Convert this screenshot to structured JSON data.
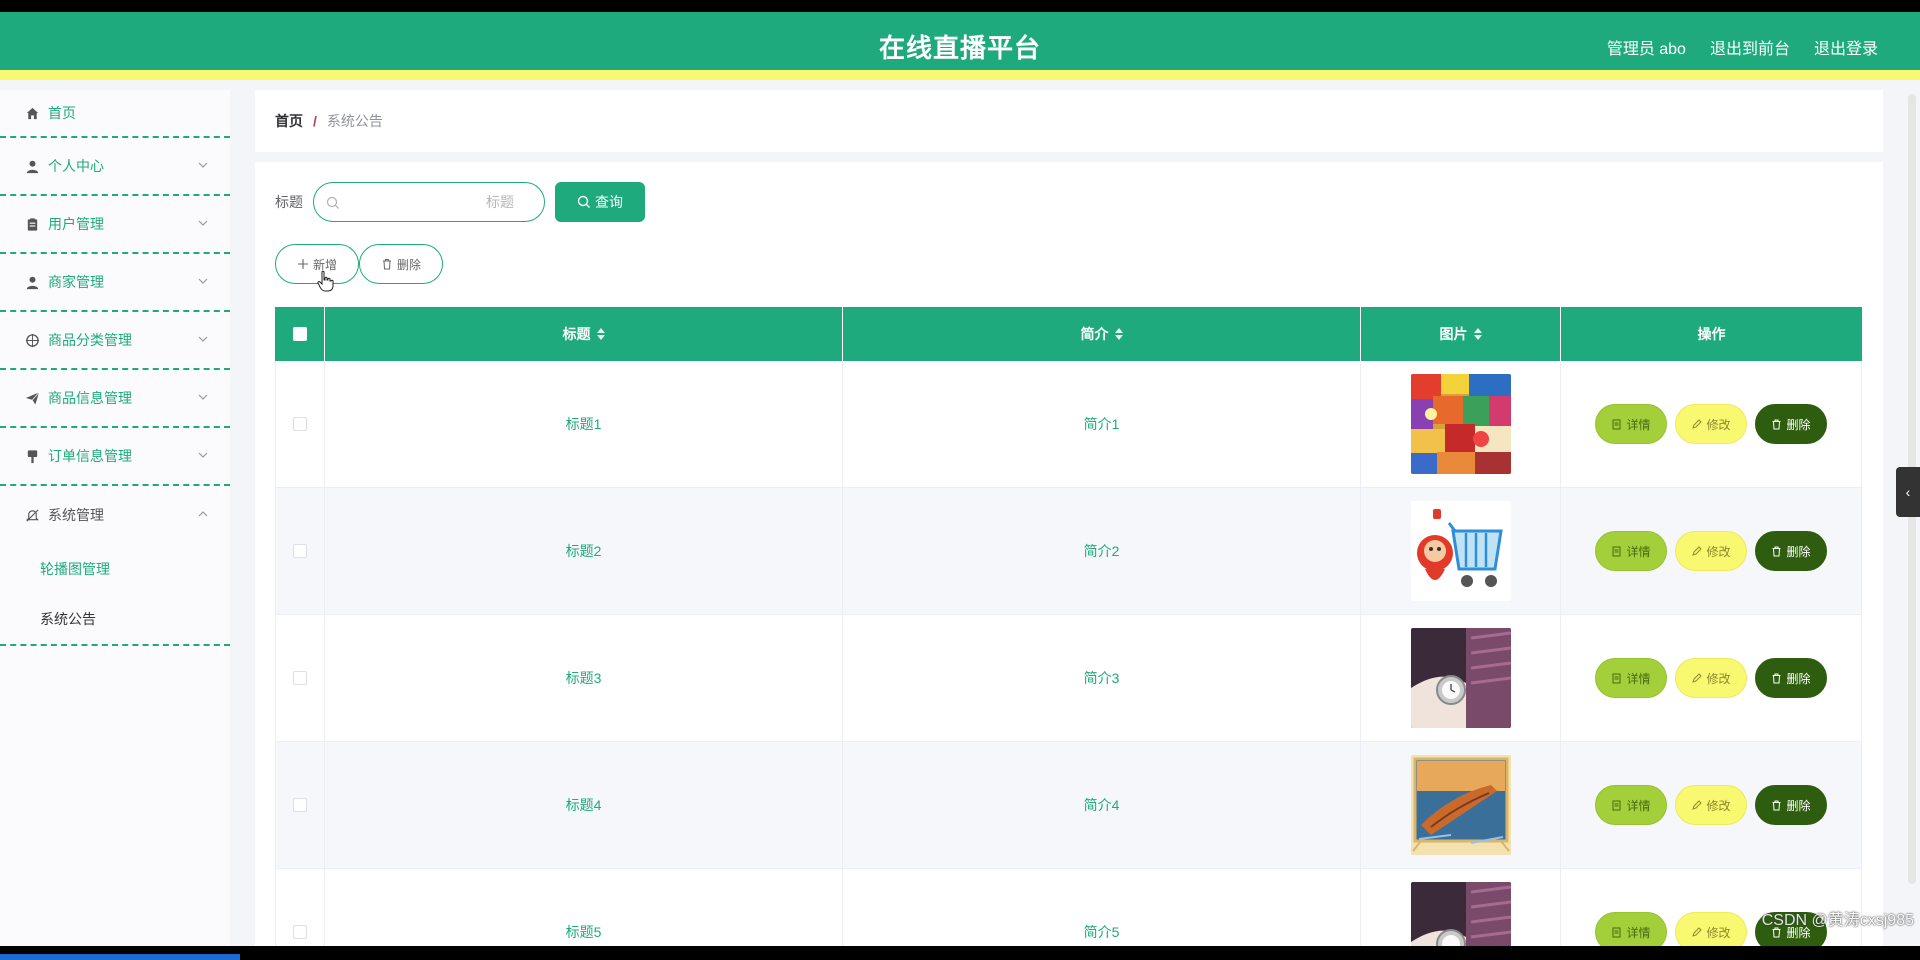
{
  "header": {
    "title": "在线直播平台",
    "admin_label": "管理员 abo",
    "to_front": "退出到前台",
    "logout": "退出登录"
  },
  "sidebar": {
    "items": [
      {
        "label": "首页",
        "icon": "home-icon"
      },
      {
        "label": "个人中心",
        "icon": "user-icon"
      },
      {
        "label": "用户管理",
        "icon": "clipboard-icon"
      },
      {
        "label": "商家管理",
        "icon": "user-icon"
      },
      {
        "label": "商品分类管理",
        "icon": "target-icon"
      },
      {
        "label": "商品信息管理",
        "icon": "send-icon"
      },
      {
        "label": "订单信息管理",
        "icon": "brush-icon"
      },
      {
        "label": "系统管理",
        "icon": "bell-off-icon"
      }
    ],
    "sub_items": [
      "轮播图管理",
      "系统公告"
    ]
  },
  "breadcrumb": {
    "home": "首页",
    "separator": "/",
    "current": "系统公告"
  },
  "search": {
    "label": "标题",
    "placeholder": "标题",
    "value": "",
    "button": "查询"
  },
  "actions": {
    "add": "新增",
    "delete": "删除"
  },
  "table": {
    "columns": [
      "标题",
      "简介",
      "图片",
      "操作"
    ],
    "rows": [
      {
        "title": "标题1",
        "intro": "简介1",
        "image": "snacks"
      },
      {
        "title": "标题2",
        "intro": "简介2",
        "image": "cart"
      },
      {
        "title": "标题3",
        "intro": "简介3",
        "image": "watch"
      },
      {
        "title": "标题4",
        "intro": "简介4",
        "image": "boat"
      },
      {
        "title": "标题5",
        "intro": "简介5",
        "image": "watch"
      }
    ],
    "op_detail": "详情",
    "op_edit": "修改",
    "op_delete": "删除"
  },
  "watermark": "CSDN @黄涛cxsj985",
  "colors": {
    "primary": "#1eaa7c",
    "accent_yellow": "#f9f871",
    "detail": "#a3cf3a",
    "delete": "#2e5d0f"
  }
}
